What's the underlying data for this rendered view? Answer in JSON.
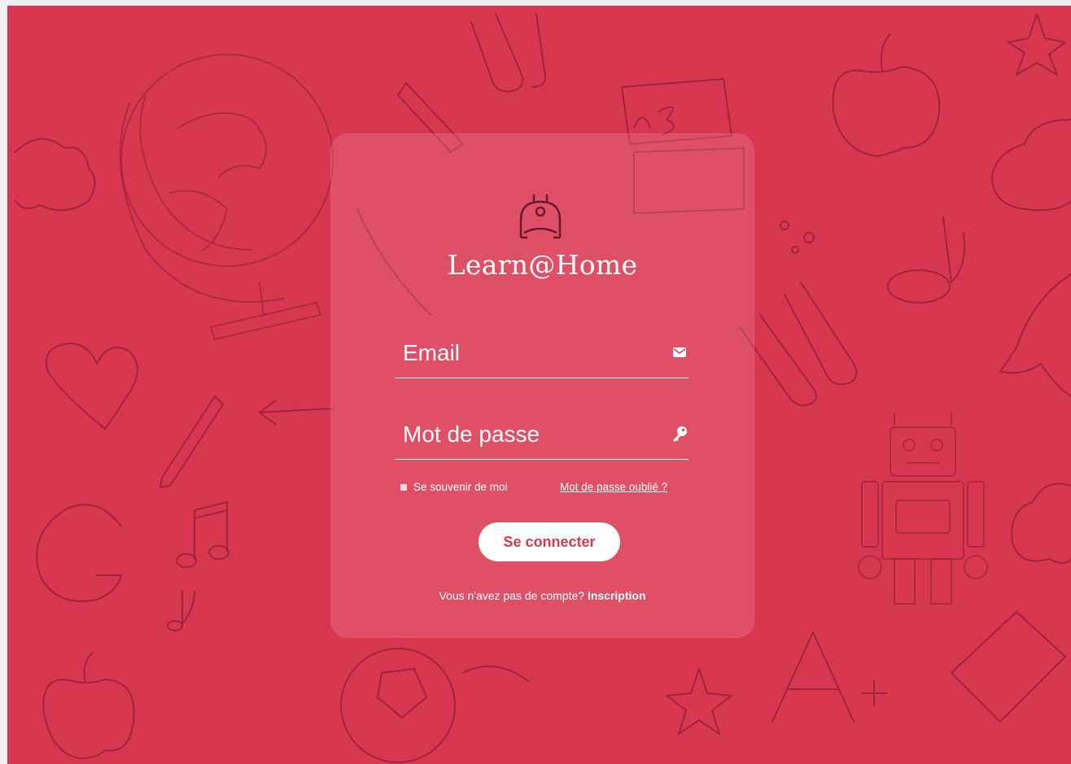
{
  "brand": {
    "name": "Learn@Home",
    "logo_icon": "robot-helmet-icon"
  },
  "form": {
    "email_label": "Email",
    "email_icon": "envelope-icon",
    "password_label": "Mot de passe",
    "password_icon": "key-icon",
    "remember_label": "Se souvenir de moi",
    "forgot_label": "Mot de passe oublié ?",
    "submit_label": "Se connecter",
    "signup_prompt": "Vous n'avez pas de compte?",
    "signup_link": "Inscription"
  },
  "colors": {
    "background": "#d73850",
    "doodle_stroke": "#8e1d33",
    "card": "rgba(240,130,148,0.32)",
    "button_text": "#d73850"
  }
}
